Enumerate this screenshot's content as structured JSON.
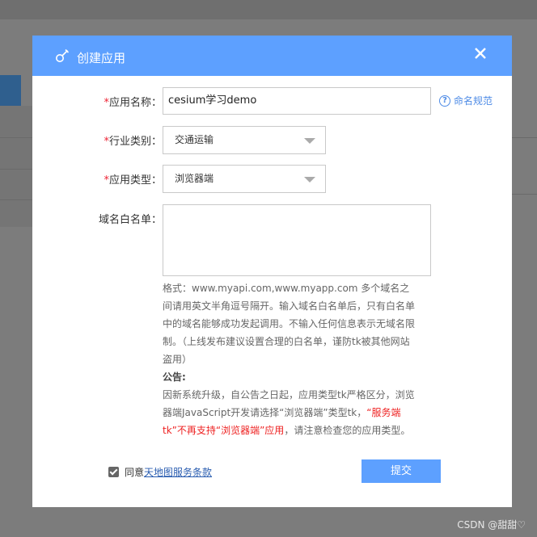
{
  "dialog": {
    "title": "创建应用"
  },
  "form": {
    "app_name": {
      "label": "应用名称：",
      "value": "cesium学习demo"
    },
    "naming_rules": "命名规范",
    "industry": {
      "label": "行业类别：",
      "selected": "交通运输"
    },
    "app_type": {
      "label": "应用类型：",
      "selected": "浏览器端"
    },
    "whitelist": {
      "label": "域名白名单："
    },
    "required_mark": "*"
  },
  "note": {
    "format_text": "格式：www.myapi.com,www.myapp.com 多个域名之间请用英文半角逗号隔开。输入域名白名单后，只有白名单中的域名能够成功发起调用。不输入任何信息表示无域名限制。（上线发布建议设置合理的白名单，谨防tk被其他网站盗用）",
    "announcement_title": "公告:",
    "announcement_part1": "因新系统升级，自公告之日起，应用类型tk严格区分，浏览器端JavaScript开发请选择“浏览器端”类型tk，",
    "announcement_red": "“服务端tk”不再支持“浏览器端”应用",
    "announcement_part2": "，请注意检查您的应用类型。"
  },
  "footer": {
    "agree_prefix": "同意",
    "terms_link": "天地图服务条款",
    "submit_label": "提交"
  },
  "watermark": "CSDN @甜甜♡",
  "colors": {
    "header": "#5da0ff",
    "link": "#2a5db0",
    "required": "#e22"
  }
}
